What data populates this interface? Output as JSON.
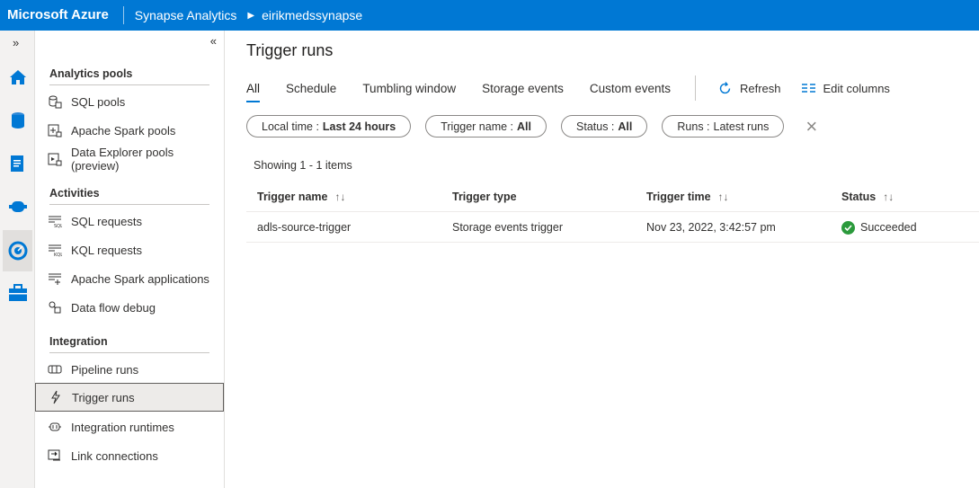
{
  "topbar": {
    "brand": "Microsoft Azure",
    "service": "Synapse Analytics",
    "workspace": "eirikmedssynapse",
    "color": "#0078d4"
  },
  "rail": {
    "expand_glyph": "»",
    "icons": [
      "home-icon",
      "data-icon",
      "develop-icon",
      "integrate-icon",
      "monitor-icon",
      "manage-icon"
    ],
    "active": "monitor-icon"
  },
  "nav": {
    "collapse_glyph": "«",
    "sections": [
      {
        "title": "Analytics pools",
        "items": [
          {
            "label": "SQL pools",
            "icon": "sql-pool-icon"
          },
          {
            "label": "Apache Spark pools",
            "icon": "spark-pool-icon"
          },
          {
            "label": "Data Explorer pools (preview)",
            "icon": "data-explorer-icon"
          }
        ]
      },
      {
        "title": "Activities",
        "items": [
          {
            "label": "SQL requests",
            "icon": "sql-requests-icon"
          },
          {
            "label": "KQL requests",
            "icon": "kql-requests-icon"
          },
          {
            "label": "Apache Spark applications",
            "icon": "spark-apps-icon"
          },
          {
            "label": "Data flow debug",
            "icon": "dataflow-debug-icon"
          }
        ]
      },
      {
        "title": "Integration",
        "items": [
          {
            "label": "Pipeline runs",
            "icon": "pipeline-runs-icon"
          },
          {
            "label": "Trigger runs",
            "icon": "trigger-runs-icon",
            "selected": true
          },
          {
            "label": "Integration runtimes",
            "icon": "integration-runtime-icon"
          },
          {
            "label": "Link connections",
            "icon": "link-connections-icon"
          }
        ]
      }
    ]
  },
  "main": {
    "title": "Trigger runs",
    "tabs": [
      "All",
      "Schedule",
      "Tumbling window",
      "Storage events",
      "Custom events"
    ],
    "active_tab": "All",
    "commands": {
      "refresh": "Refresh",
      "edit_columns": "Edit columns"
    },
    "filters": [
      {
        "label": "Local time :",
        "value": "Last 24 hours"
      },
      {
        "label": "Trigger name :",
        "value": "All"
      },
      {
        "label": "Status :",
        "value": "All"
      },
      {
        "label": "Runs :",
        "value": "Latest runs"
      }
    ],
    "showing": "Showing 1 - 1 items",
    "columns": [
      "Trigger name",
      "Trigger type",
      "Trigger time",
      "Status"
    ],
    "rows": [
      {
        "name": "adls-source-trigger",
        "type": "Storage events trigger",
        "time": "Nov 23, 2022, 3:42:57 pm",
        "status": "Succeeded",
        "status_color": "#2b9a3c"
      }
    ]
  }
}
